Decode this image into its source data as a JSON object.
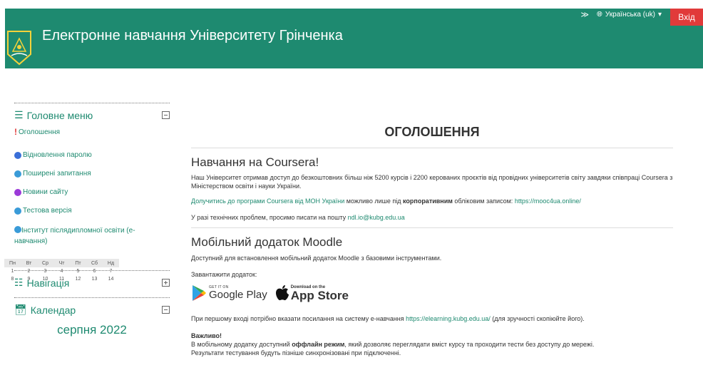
{
  "header": {
    "title": "Електронне навчання Університету Грінченка",
    "language": "Українська (uk)",
    "login": "Вхід"
  },
  "sidebar": {
    "main_menu": {
      "title": "Головне меню",
      "items": [
        {
          "label": "Оголошення",
          "icon": "exclamation-icon",
          "color": "#e13a3a"
        },
        {
          "label": "Відновлення паролю",
          "icon": "key-icon",
          "color": "#3a6fd8"
        },
        {
          "label": "Поширені запитання",
          "icon": "help-icon",
          "color": "#3a9bd8"
        },
        {
          "label": "Новини сайту",
          "icon": "news-icon",
          "color": "#9b3ad8"
        },
        {
          "label": "Тестова версія",
          "icon": "test-icon",
          "color": "#3a9bd8"
        },
        {
          "label": "Інститут післядипломної освіти (е-навчання)",
          "icon": "institute-icon",
          "color": "#3a9bd8"
        }
      ]
    },
    "navigation": {
      "title": "Навігація"
    },
    "calendar": {
      "title": "Календар",
      "month": "серпня 2022",
      "weekdays": [
        "Пн",
        "Вт",
        "Ср",
        "Чт",
        "Пт",
        "Сб",
        "Нд"
      ],
      "weeks": [
        [
          "1",
          "2",
          "3",
          "4",
          "5",
          "6",
          "7"
        ],
        [
          "8",
          "9",
          "10",
          "11",
          "12",
          "13",
          "14"
        ]
      ]
    }
  },
  "main": {
    "heading": "ОГОЛОШЕННЯ",
    "coursera": {
      "title": "Навчання на Coursera!",
      "text": "Наш Університет отримав доступ до безкоштовних більш ніж 5200 курсів і 2200 керованих проєктів від провідних університетів світу завдяки співпраці Coursera з Міністерством освіти і науки України.",
      "join_link": "Долучитись до програми Coursera від МОН України",
      "join_mid": " можливо лише під ",
      "join_bold": "корпоративним",
      "join_end": " обліковим записом: ",
      "mooc_link": "https://mooc4ua.online/",
      "support": "У разі технічних проблем, просимо писати на пошту ",
      "support_email": "ndl.io@kubg.edu.ua"
    },
    "mobile": {
      "title": "Мобільний додаток Moodle",
      "desc": "Доступний для встановлення мобільний додаток Moodle з базовими інструментами.",
      "download": "Завантажити додаток:",
      "gp_small": "GET IT ON",
      "gp_big": "Google Play",
      "as_small": "Download on the",
      "as_big": "App Store",
      "first_login": "При першому вході потрібно вказати посилання на систему е-навчання ",
      "url": "https://elearning.kubg.edu.ua/",
      "first_login_end": " (для зручності скопіюйте його).",
      "important": "Важливо!",
      "offline_pre": "В мобільному додатку доступний ",
      "offline_bold": "оффлайн режим",
      "offline_post": ", який дозволяє переглядати вміст курсу та проходити тести без доступу до мережі.",
      "sync": "Результати тестування будуть пізніше синхронізовані при підключенні."
    }
  }
}
